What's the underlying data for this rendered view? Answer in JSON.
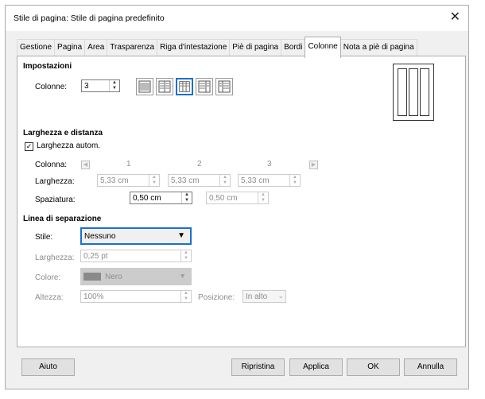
{
  "window": {
    "title": "Stile di pagina: Stile di pagina predefinito"
  },
  "tabs": [
    "Gestione",
    "Pagina",
    "Area",
    "Trasparenza",
    "Riga d'intestazione",
    "Piè di pagina",
    "Bordi",
    "Colonne",
    "Nota a piè di pagina"
  ],
  "active_tab": "Colonne",
  "settings": {
    "heading": "Impostazioni",
    "columns_label": "Colonne:",
    "columns_value": "3",
    "selected_layout": 3
  },
  "width_spacing": {
    "heading": "Larghezza e distanza",
    "auto_width_label": "Larghezza autom.",
    "auto_width_checked": true,
    "column_label": "Colonna:",
    "column_numbers": [
      "1",
      "2",
      "3"
    ],
    "width_label": "Larghezza:",
    "widths": [
      "5,33 cm",
      "5,33 cm",
      "5,33 cm"
    ],
    "spacing_label": "Spaziatura:",
    "spacings": [
      "0,50 cm",
      "0,50 cm"
    ]
  },
  "separator": {
    "heading": "Linea di separazione",
    "style_label": "Stile:",
    "style_value": "Nessuno",
    "width_label": "Larghezza:",
    "width_value": "0,25 pt",
    "color_label": "Colore:",
    "color_value": "Nero",
    "height_label": "Altezza:",
    "height_value": "100%",
    "position_label": "Posizione:",
    "position_value": "In alto"
  },
  "buttons": {
    "help": "Aiuto",
    "reset": "Ripristina",
    "apply": "Applica",
    "ok": "OK",
    "cancel": "Annulla"
  },
  "colors": {
    "focus": "#1a6fd1"
  }
}
